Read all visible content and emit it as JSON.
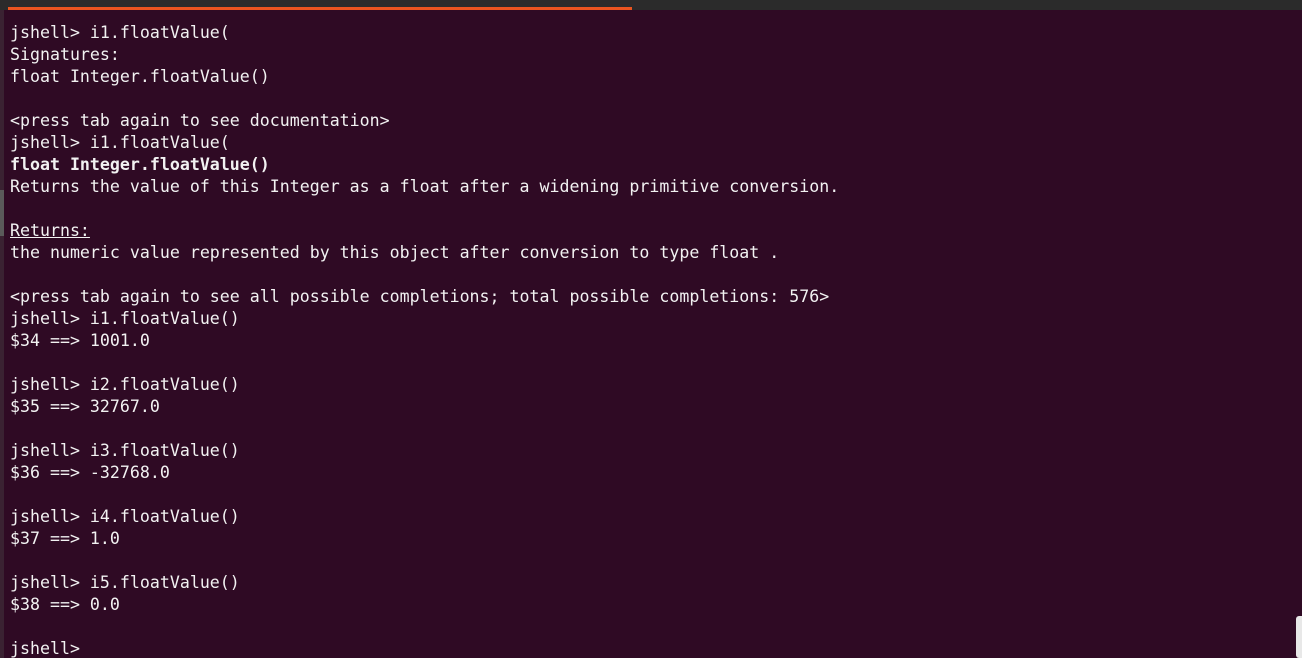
{
  "terminal": {
    "accent_color": "#e95420",
    "background_color": "#2f0a24",
    "lines": [
      {
        "text": "jshell> i1.floatValue(",
        "style": "normal"
      },
      {
        "text": "Signatures:",
        "style": "normal"
      },
      {
        "text": "float Integer.floatValue()",
        "style": "normal"
      },
      {
        "text": "",
        "style": "normal"
      },
      {
        "text": "<press tab again to see documentation>",
        "style": "normal"
      },
      {
        "text": "jshell> i1.floatValue(",
        "style": "normal"
      },
      {
        "text": "float Integer.floatValue()",
        "style": "bold"
      },
      {
        "text": "Returns the value of this Integer as a float after a widening primitive conversion.",
        "style": "normal"
      },
      {
        "text": "",
        "style": "normal"
      },
      {
        "text": "Returns:",
        "style": "underline"
      },
      {
        "text": "the numeric value represented by this object after conversion to type float .",
        "style": "normal"
      },
      {
        "text": "",
        "style": "normal"
      },
      {
        "text": "<press tab again to see all possible completions; total possible completions: 576>",
        "style": "normal"
      },
      {
        "text": "jshell> i1.floatValue()",
        "style": "normal"
      },
      {
        "text": "$34 ==> 1001.0",
        "style": "normal"
      },
      {
        "text": "",
        "style": "normal"
      },
      {
        "text": "jshell> i2.floatValue()",
        "style": "normal"
      },
      {
        "text": "$35 ==> 32767.0",
        "style": "normal"
      },
      {
        "text": "",
        "style": "normal"
      },
      {
        "text": "jshell> i3.floatValue()",
        "style": "normal"
      },
      {
        "text": "$36 ==> -32768.0",
        "style": "normal"
      },
      {
        "text": "",
        "style": "normal"
      },
      {
        "text": "jshell> i4.floatValue()",
        "style": "normal"
      },
      {
        "text": "$37 ==> 1.0",
        "style": "normal"
      },
      {
        "text": "",
        "style": "normal"
      },
      {
        "text": "jshell> i5.floatValue()",
        "style": "normal"
      },
      {
        "text": "$38 ==> 0.0",
        "style": "normal"
      },
      {
        "text": "",
        "style": "normal"
      },
      {
        "text": "jshell>",
        "style": "normal"
      }
    ]
  }
}
